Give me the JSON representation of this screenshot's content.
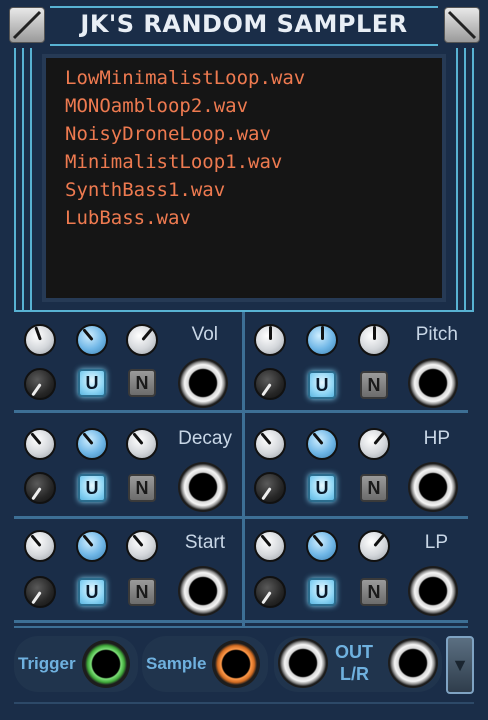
{
  "module": {
    "title": "JK'S RANDOM SAMPLER"
  },
  "files": [
    "LowMinimalistLoop.wav",
    "MONOambloop2.wav",
    "NoisyDroneLoop.wav",
    "MinimalistLoop1.wav",
    "SynthBass1.wav",
    "LubBass.wav"
  ],
  "sections": {
    "vol": {
      "label": "Vol"
    },
    "pitch": {
      "label": "Pitch"
    },
    "decay": {
      "label": "Decay"
    },
    "hp": {
      "label": "HP"
    },
    "start": {
      "label": "Start"
    },
    "lp": {
      "label": "LP"
    }
  },
  "buttons": {
    "u_label": "U",
    "n_label": "N"
  },
  "bottom": {
    "trigger_label": "Trigger",
    "sample_label": "Sample",
    "out_label_line1": "OUT",
    "out_label_line2": "L/R",
    "menu_arrow": "▼"
  },
  "colors": {
    "panel_bg": "#1a2d48",
    "accent_line": "#58b2d3",
    "file_text": "#ee7a50",
    "u_button": "#8fd6f5",
    "bottom_label": "#6fb1df"
  },
  "icons": {
    "corner_left": "screw-icon",
    "corner_right": "screw-icon"
  }
}
